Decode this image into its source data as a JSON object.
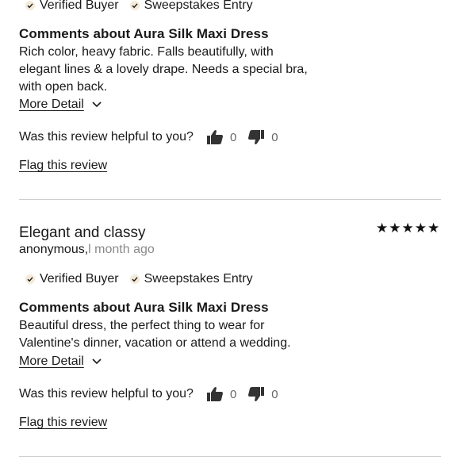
{
  "reviews": [
    {
      "badges": [
        "Verified Buyer",
        "Sweepstakes Entry"
      ],
      "comment_heading": "Comments about Aura Silk Maxi Dress",
      "comment_lines": [
        "Rich color, heavy fabric. Falls beautifully, with",
        "elegant lines & a lovely drape. Needs a special bra,",
        "with open back."
      ],
      "more_detail_label": "More Detail",
      "helpful_question": "Was this review helpful to you?",
      "helpful_yes_count": "0",
      "helpful_no_count": "0",
      "flag_label": "Flag this review"
    },
    {
      "title": "Elegant and classy",
      "author": "anonymous,",
      "date": "l month ago",
      "rating_stars": "★★★★★",
      "rating": 5,
      "badges": [
        "Verified Buyer",
        "Sweepstakes Entry"
      ],
      "comment_heading": "Comments about Aura Silk Maxi Dress",
      "comment_lines": [
        "Beautiful dress, the perfect thing to wear for",
        "Valentine's dinner, vacation or attend a wedding."
      ],
      "more_detail_label": "More Detail",
      "helpful_question": "Was this review helpful to you?",
      "helpful_yes_count": "0",
      "helpful_no_count": "0",
      "flag_label": "Flag this review"
    }
  ],
  "icons": {
    "check": "check-icon",
    "thumbs_up": "thumbs-up-icon",
    "thumbs_down": "thumbs-down-icon",
    "chevron": "chevron-down-icon"
  },
  "colors": {
    "check_bg": "#f3ead8",
    "divider": "#cfcfcf",
    "muted_text": "#8a8a8a"
  }
}
